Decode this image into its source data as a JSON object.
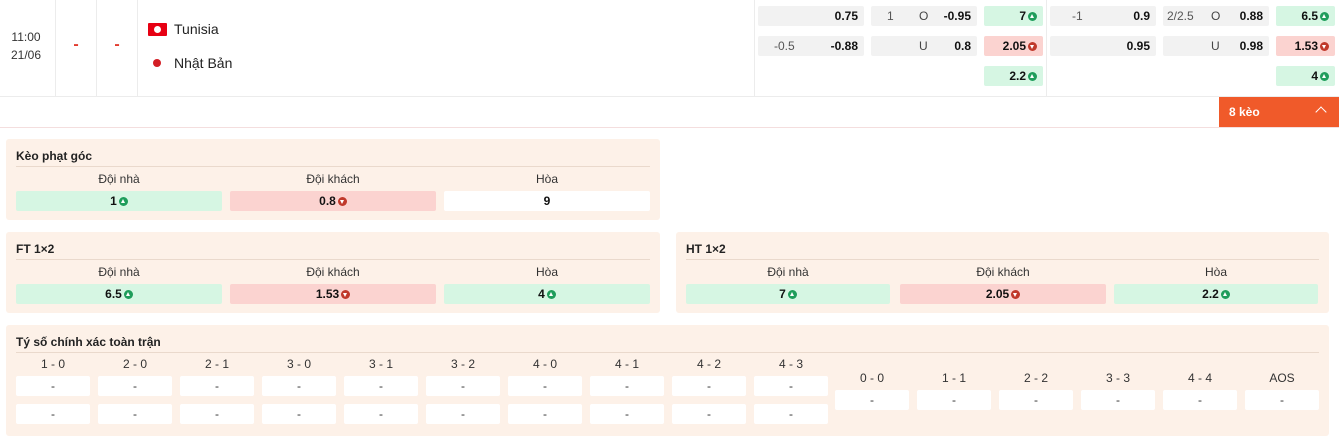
{
  "match": {
    "time": "11:00",
    "date": "21/06",
    "score_home": "-",
    "score_away": "-",
    "home_team": "Tunisia",
    "away_team": "Nhật Bản",
    "home_flag": "tunisia-flag-icon",
    "away_flag": "japan-flag-icon"
  },
  "odds": {
    "ft_handicap": {
      "home_value": "0.75",
      "line": "-0.5",
      "away_value": "-0.88"
    },
    "ft_over_under": {
      "line": "1",
      "over_label": "O",
      "over_value": "-0.95",
      "under_label": "U",
      "under_value": "0.8"
    },
    "ft_1x2": {
      "home": "7",
      "away": "2.05",
      "draw": "2.2"
    },
    "ht_handicap": {
      "line": "-1",
      "home_value": "0.9",
      "away_value": "0.95"
    },
    "ht_over_under": {
      "line": "2/2.5",
      "over_label": "O",
      "over_value": "0.88",
      "under_label": "U",
      "under_value": "0.98"
    },
    "ht_1x2": {
      "home": "6.5",
      "away": "1.53",
      "draw": "4"
    }
  },
  "more_button": {
    "label": "8 kèo"
  },
  "corner_panel": {
    "title": "Kèo phạt góc",
    "headers": [
      "Đội nhà",
      "Đội khách",
      "Hòa"
    ],
    "values": [
      "1",
      "0.8",
      "9"
    ]
  },
  "ft_panel": {
    "title": "FT 1×2",
    "headers": [
      "Đội nhà",
      "Đội khách",
      "Hòa"
    ],
    "values": [
      "6.5",
      "1.53",
      "4"
    ]
  },
  "ht_panel": {
    "title": "HT 1×2",
    "headers": [
      "Đội nhà",
      "Đội khách",
      "Hòa"
    ],
    "values": [
      "7",
      "2.05",
      "2.2"
    ]
  },
  "correct_score": {
    "title": "Tý số chính xác toàn trận",
    "home_scores": [
      {
        "label": "1 - 0",
        "v1": "-",
        "v2": "-"
      },
      {
        "label": "2 - 0",
        "v1": "-",
        "v2": "-"
      },
      {
        "label": "2 - 1",
        "v1": "-",
        "v2": "-"
      },
      {
        "label": "3 - 0",
        "v1": "-",
        "v2": "-"
      },
      {
        "label": "3 - 1",
        "v1": "-",
        "v2": "-"
      },
      {
        "label": "3 - 2",
        "v1": "-",
        "v2": "-"
      },
      {
        "label": "4 - 0",
        "v1": "-",
        "v2": "-"
      },
      {
        "label": "4 - 1",
        "v1": "-",
        "v2": "-"
      },
      {
        "label": "4 - 2",
        "v1": "-",
        "v2": "-"
      },
      {
        "label": "4 - 3",
        "v1": "-",
        "v2": "-"
      }
    ],
    "draw_scores": [
      {
        "label": "0 - 0",
        "v1": "-"
      },
      {
        "label": "1 - 1",
        "v1": "-"
      },
      {
        "label": "2 - 2",
        "v1": "-"
      },
      {
        "label": "3 - 3",
        "v1": "-"
      },
      {
        "label": "4 - 4",
        "v1": "-"
      },
      {
        "label": "AOS",
        "v1": "-"
      }
    ]
  },
  "colors": {
    "accent": "#f05a2a",
    "up": "#1f9d5b",
    "down": "#c0392b",
    "panel_bg": "#fdf1e8",
    "green_cell": "#d6f6e3",
    "red_cell": "#fbd3d0"
  }
}
